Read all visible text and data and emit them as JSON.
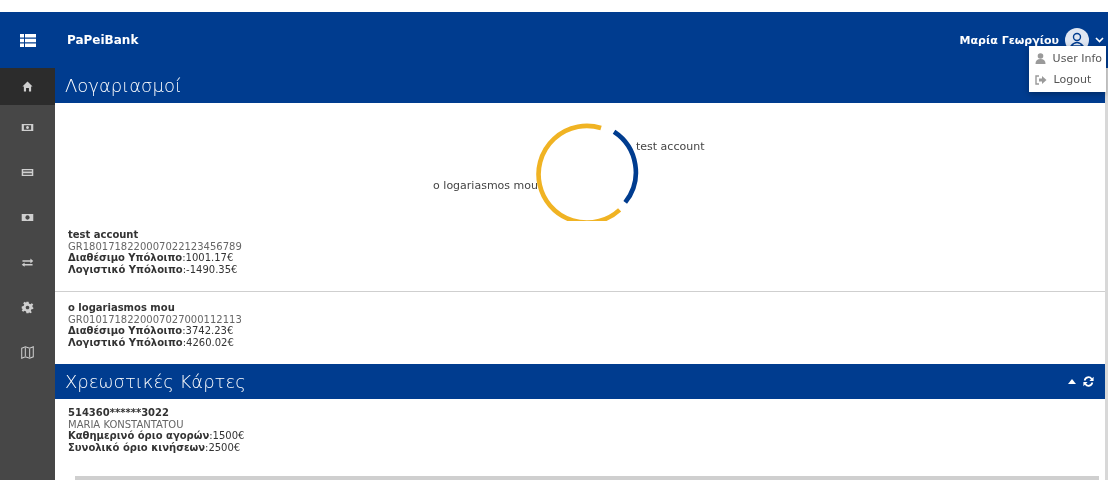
{
  "header": {
    "brand": "PaPeiBank",
    "user_name": "Μαρία Γεωργίου"
  },
  "user_menu": {
    "expanded": true,
    "items": [
      {
        "kind": "user",
        "label": "User Info"
      },
      {
        "kind": "logout",
        "label": "Logout"
      }
    ]
  },
  "sidebar": {
    "items": [
      {
        "kind": "home",
        "selected": true
      },
      {
        "kind": "money",
        "selected": false
      },
      {
        "kind": "card",
        "selected": false
      },
      {
        "kind": "cash",
        "selected": false
      },
      {
        "kind": "transfer",
        "selected": false
      },
      {
        "kind": "settings",
        "selected": false
      },
      {
        "kind": "map",
        "selected": false
      }
    ]
  },
  "accounts": {
    "title": "Λογαριασμοί",
    "chart": {
      "labels": [
        "test account",
        "o logariasmos mou"
      ]
    },
    "items": [
      {
        "name": "test account",
        "iban": "GR1801718220007022123456789",
        "available": "**Διαθέσιμο Υπόλοιπο**:1001.17€",
        "ledger": "**Λογιστικό Υπόλοιπο**:-1490.35€"
      },
      {
        "name": "o logariasmos mou",
        "iban": "GR0101718220007027000112113",
        "available": "**Διαθέσιμο Υπόλοιπο**:3742.23€",
        "ledger": "**Λογιστικό Υπόλοιπο**:4260.02€"
      }
    ]
  },
  "debit_cards": {
    "title": "Χρεωστικές Κάρτες",
    "items": [
      {
        "number": "514360******3022",
        "holder": "MARIA KONSTANTATOU",
        "daily": "**Καθημερινό όριο αγορών**:1500€",
        "total": "**Συνολικό όριο κινήσεων**:2500€"
      }
    ]
  }
}
